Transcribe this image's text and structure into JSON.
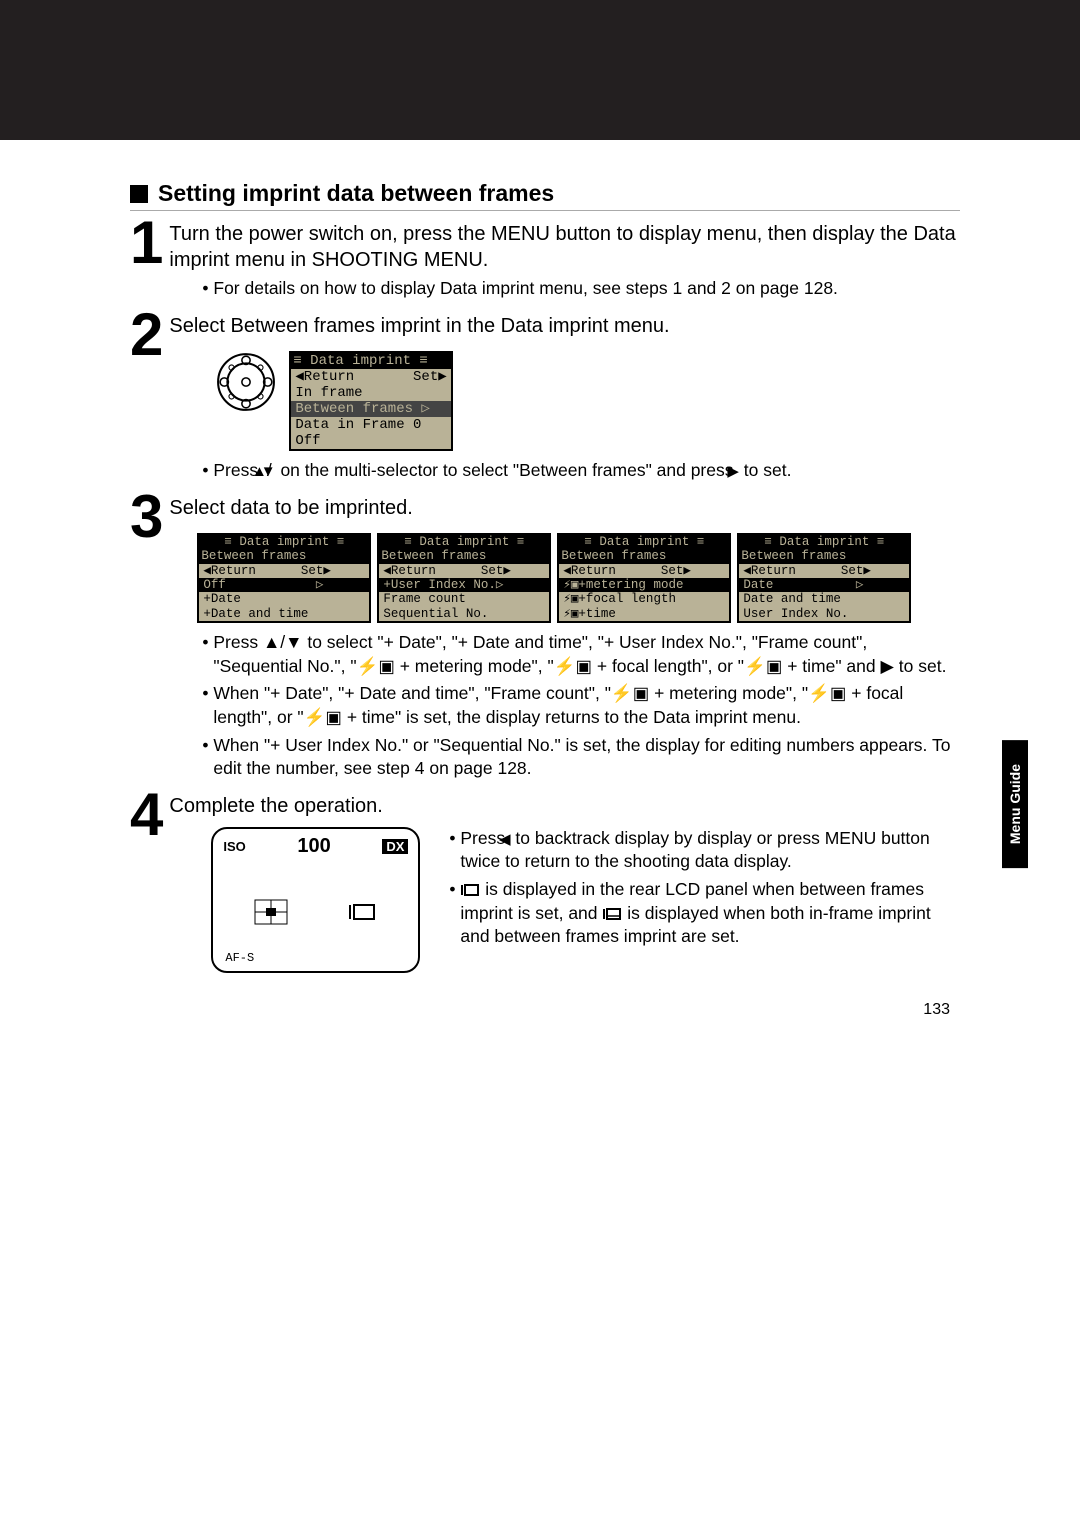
{
  "heading": "Setting imprint data between frames",
  "steps": {
    "s1": {
      "num": "1",
      "main": "Turn the power switch on, press the MENU button to display menu, then display the Data imprint menu in SHOOTING MENU.",
      "b1": "For details on how to display Data imprint menu, see steps 1 and 2 on page 128."
    },
    "s2": {
      "num": "2",
      "main": "Select Between frames imprint in the Data imprint menu.",
      "lcd": {
        "title_l": "≡ Data imprint ≡",
        "row_ret": "◀Return       Set▶",
        "row_in": "In frame",
        "row_bf": "Between frames ▷",
        "row_df": "Data in Frame 0",
        "row_off": "Off"
      },
      "b1_a": "Press ",
      "b1_b": " on the multi-selector to select \"Between frames\" and press ",
      "b1_c": " to set."
    },
    "s3": {
      "num": "3",
      "main": "Select data to be imprinted.",
      "screens": {
        "title": "≡ Data imprint ≡",
        "sub": " Between frames ",
        "ret": "◀Return      Set▶",
        "scr1": {
          "hl": "Off            ▷",
          "r2": "+Date",
          "r3": "+Date and time"
        },
        "scr2": {
          "hl": "+User Index No.▷",
          "r2": "Frame count",
          "r3": "Sequential No."
        },
        "scr3": {
          "hl": "⚡▣+metering mode",
          "r2": "⚡▣+focal length",
          "r3": "⚡▣+time"
        },
        "scr4": {
          "hl": "Date           ▷",
          "r2": "Date and time",
          "r3": "User Index No."
        }
      },
      "b1": "Press ▲/▼ to select \"+ Date\", \"+ Date and time\", \"+ User Index No.\", \"Frame count\", \"Sequential No.\", \"⚡▣ + metering mode\", \"⚡▣ + focal length\", or \"⚡▣ + time\" and ▶ to set.",
      "b2": "When \"+ Date\", \"+ Date and time\", \"Frame count\", \"⚡▣ + metering mode\", \"⚡▣ + focal length\", or \"⚡▣ + time\" is set, the display returns to the Data imprint menu.",
      "b3": "When \"+ User Index No.\" or \"Sequential No.\" is set, the display for editing numbers appears. To edit the number, see step 4 on page 128."
    },
    "s4": {
      "num": "4",
      "main": "Complete the operation.",
      "rear": {
        "iso": "ISO",
        "num": "100",
        "dx": "DX",
        "af": "AF-S"
      },
      "b1_a": "Press ",
      "b1_b": " to backtrack display by display or press MENU button twice to return to the shooting data display.",
      "b2_a": " is displayed in the rear LCD panel when between frames imprint is set, and ",
      "b2_b": " is displayed when both in-frame imprint and between frames imprint are set."
    }
  },
  "side_tab": "Menu Guide",
  "page_number": "133"
}
